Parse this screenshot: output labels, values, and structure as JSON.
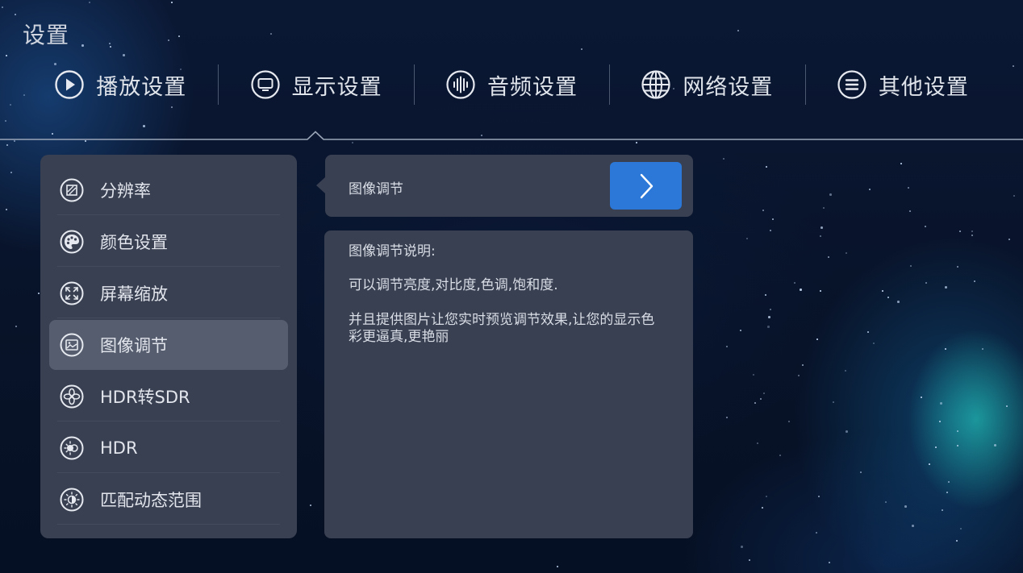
{
  "page": {
    "title": "设置"
  },
  "top_tabs": [
    {
      "label": "播放设置",
      "icon": "play-circle-icon"
    },
    {
      "label": "显示设置",
      "icon": "monitor-icon",
      "active": true
    },
    {
      "label": "音频设置",
      "icon": "audio-wave-icon"
    },
    {
      "label": "网络设置",
      "icon": "globe-icon"
    },
    {
      "label": "其他设置",
      "icon": "menu-lines-icon"
    }
  ],
  "display_menu": {
    "items": [
      {
        "label": "分辨率",
        "icon": "resolution-icon"
      },
      {
        "label": "颜色设置",
        "icon": "palette-icon"
      },
      {
        "label": "屏幕缩放",
        "icon": "screen-scale-icon"
      },
      {
        "label": "图像调节",
        "icon": "image-adjust-icon",
        "selected": true
      },
      {
        "label": "HDR转SDR",
        "icon": "hdr-to-sdr-icon"
      },
      {
        "label": "HDR",
        "icon": "hdr-icon"
      },
      {
        "label": "匹配动态范围",
        "icon": "dynamic-range-icon"
      }
    ]
  },
  "detail": {
    "option_label": "图像调节",
    "go_button_icon": "chevron-right-icon",
    "description_title": "图像调节说明:",
    "description_line1": "可以调节亮度,对比度,色调,饱和度.",
    "description_line2a": "并且提供图片让您实时预览调节效果,让您的显示色",
    "description_line2b": "彩更逼真,更艳丽"
  },
  "colors": {
    "panel": "#394052",
    "selected_item": "#555d6e",
    "accent_button": "#2b78d8",
    "background": "#08132b"
  }
}
